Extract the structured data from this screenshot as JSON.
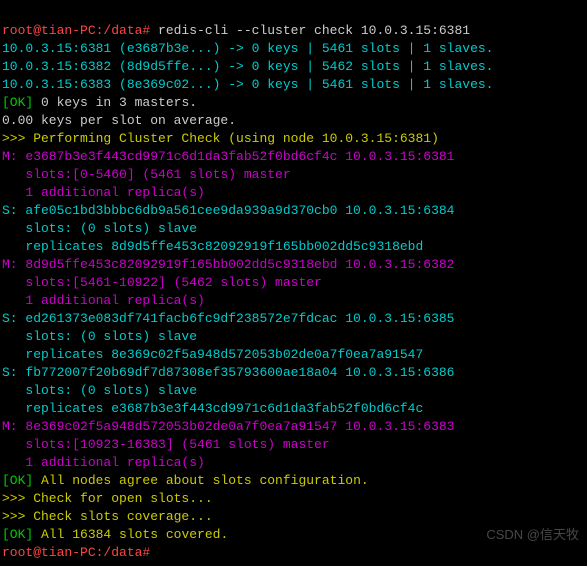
{
  "prompt1": "root@tian-PC:/data# ",
  "cmd1": "redis-cli --cluster check 10.0.3.15:6381",
  "l1": "10.0.3.15:6381 (e3687b3e...) -> 0 keys | 5461 slots | 1 slaves.",
  "l2": "10.0.3.15:6382 (8d9d5ffe...) -> 0 keys | 5462 slots | 1 slaves.",
  "l3": "10.0.3.15:6383 (8e369c02...) -> 0 keys | 5461 slots | 1 slaves.",
  "ok1": "[OK] ",
  "ok1b": "0 keys in 3 masters.",
  "avg": "0.00 keys per slot on average.",
  "hdr": ">>> Performing Cluster Check (using node 10.0.3.15:6381)",
  "m1a": "M: e3687b3e3f443cd9971c6d1da3fab52f0bd6cf4c 10.0.3.15:6381",
  "m1b": "   slots:[0-5460] (5461 slots) master",
  "m1c": "   1 additional replica(s)",
  "s1a": "S: afe05c1bd3bbbc6db9a561cee9da939a9d370cb0 10.0.3.15:6384",
  "s1b": "   slots: (0 slots) slave",
  "s1c": "   replicates 8d9d5ffe453c82092919f165bb002dd5c9318ebd",
  "m2a": "M: 8d9d5ffe453c82092919f165bb002dd5c9318ebd 10.0.3.15:6382",
  "m2b": "   slots:[5461-10922] (5462 slots) master",
  "m2c": "   1 additional replica(s)",
  "s2a": "S: ed261373e083df741facb6fc9df238572e7fdcac 10.0.3.15:6385",
  "s2b": "   slots: (0 slots) slave",
  "s2c": "   replicates 8e369c02f5a948d572053b02de0a7f0ea7a91547",
  "s3a": "S: fb772007f20b69df7d87308ef35793600ae18a04 10.0.3.15:6386",
  "s3b": "   slots: (0 slots) slave",
  "s3c": "   replicates e3687b3e3f443cd9971c6d1da3fab52f0bd6cf4c",
  "m3a": "M: 8e369c02f5a948d572053b02de0a7f0ea7a91547 10.0.3.15:6383",
  "m3b": "   slots:[10923-16383] (5461 slots) master",
  "m3c": "   1 additional replica(s)",
  "ok2": "[OK] ",
  "ok2b": "All nodes agree about slots configuration.",
  "chk1": ">>> Check for open slots...",
  "chk2": ">>> Check slots coverage...",
  "ok3": "[OK] ",
  "ok3b": "All 16384 slots covered.",
  "prompt2": "root@tian-PC:/data# ",
  "watermark": "CSDN @信天牧"
}
